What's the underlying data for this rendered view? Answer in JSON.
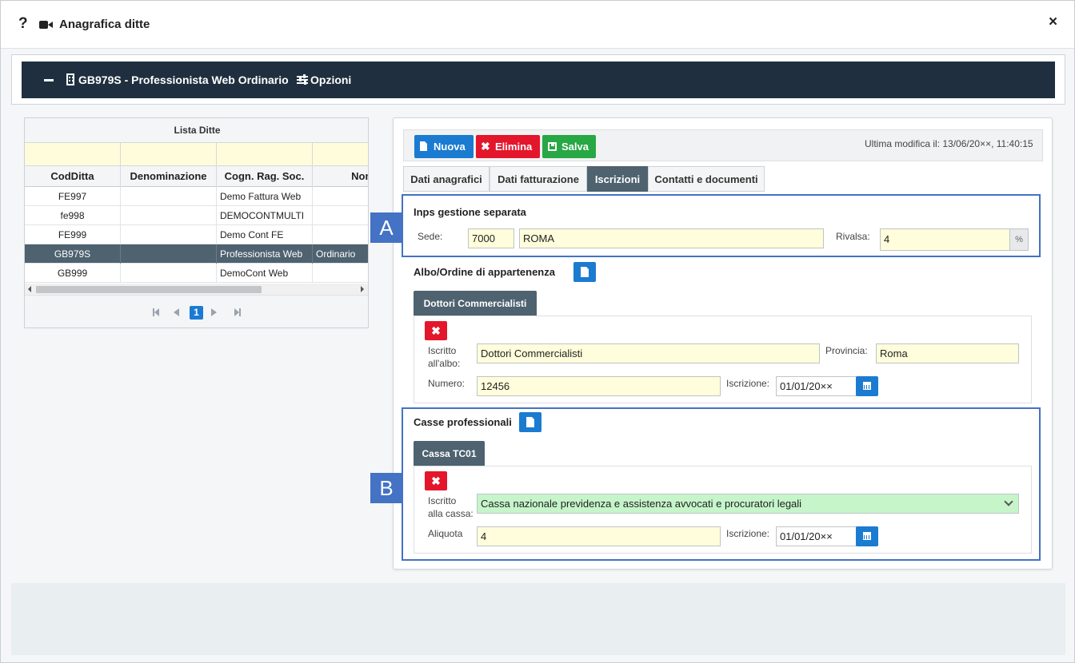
{
  "window": {
    "help_glyph": "?",
    "title": "Anagrafica ditte",
    "close_glyph": "×"
  },
  "header": {
    "title": "GB979S - Professionista Web Ordinario",
    "options_label": "Opzioni"
  },
  "grid": {
    "caption": "Lista Ditte",
    "columns": [
      "CodDitta",
      "Denominazione",
      "Cogn. Rag. Soc.",
      "Nom"
    ],
    "rows": [
      {
        "cod": "FE997",
        "den": "",
        "cogn": "Demo Fattura Web",
        "nome": ""
      },
      {
        "cod": "fe998",
        "den": "",
        "cogn": "DEMOCONTMULTI",
        "nome": ""
      },
      {
        "cod": "FE999",
        "den": "",
        "cogn": "Demo Cont FE",
        "nome": ""
      },
      {
        "cod": "GB979S",
        "den": "",
        "cogn": "Professionista Web",
        "nome": "Ordinario"
      },
      {
        "cod": "GB999",
        "den": "",
        "cogn": "DemoCont Web",
        "nome": ""
      }
    ],
    "selected_row": 3,
    "pager": {
      "current_page": "1"
    }
  },
  "toolbar": {
    "new_label": "Nuova",
    "delete_label": "Elimina",
    "save_label": "Salva",
    "last_modified": "Ultima modifica il: 13/06/20××, 11:40:15"
  },
  "tabs": [
    {
      "label": "Dati anagrafici",
      "active": false
    },
    {
      "label": "Dati fatturazione",
      "active": false
    },
    {
      "label": "Iscrizioni",
      "active": true
    },
    {
      "label": "Contatti e documenti",
      "active": false
    }
  ],
  "inps": {
    "title": "Inps gestione separata",
    "sede_label": "Sede:",
    "sede_code": "7000",
    "sede_name": "ROMA",
    "rivalsa_label": "Rivalsa:",
    "rivalsa_value": "4",
    "rivalsa_unit": "%"
  },
  "albo": {
    "title": "Albo/Ordine di appartenenza",
    "tab_label": "Dottori Commercialisti",
    "iscritto_label_1": "Iscritto",
    "iscritto_label_2": "all'albo:",
    "iscritto_value": "Dottori Commercialisti",
    "provincia_label": "Provincia:",
    "provincia_value": "Roma",
    "numero_label": "Numero:",
    "numero_value": "12456",
    "iscrizione_label": "Iscrizione:",
    "iscrizione_value": "01/01/20××"
  },
  "casse": {
    "title": "Casse professionali",
    "tab_label": "Cassa TC01",
    "iscritto_label_1": "Iscritto",
    "iscritto_label_2": "alla cassa:",
    "iscritto_value": "Cassa nazionale previdenza e assistenza avvocati e procuratori legali",
    "aliquota_label": "Aliquota",
    "aliquota_value": "4",
    "iscrizione_label": "Iscrizione:",
    "iscrizione_value": "01/01/20××"
  },
  "callouts": {
    "a": "A",
    "b": "B"
  },
  "colors": {
    "header_bg": "#1f2f3f",
    "accent_blue": "#1a7bd1",
    "danger_red": "#e3162c",
    "success_green": "#28a745",
    "tab_active": "#4e6270",
    "callout_blue": "#4472c4",
    "input_yellow": "#fffddb",
    "input_green": "#c5f5c9"
  }
}
